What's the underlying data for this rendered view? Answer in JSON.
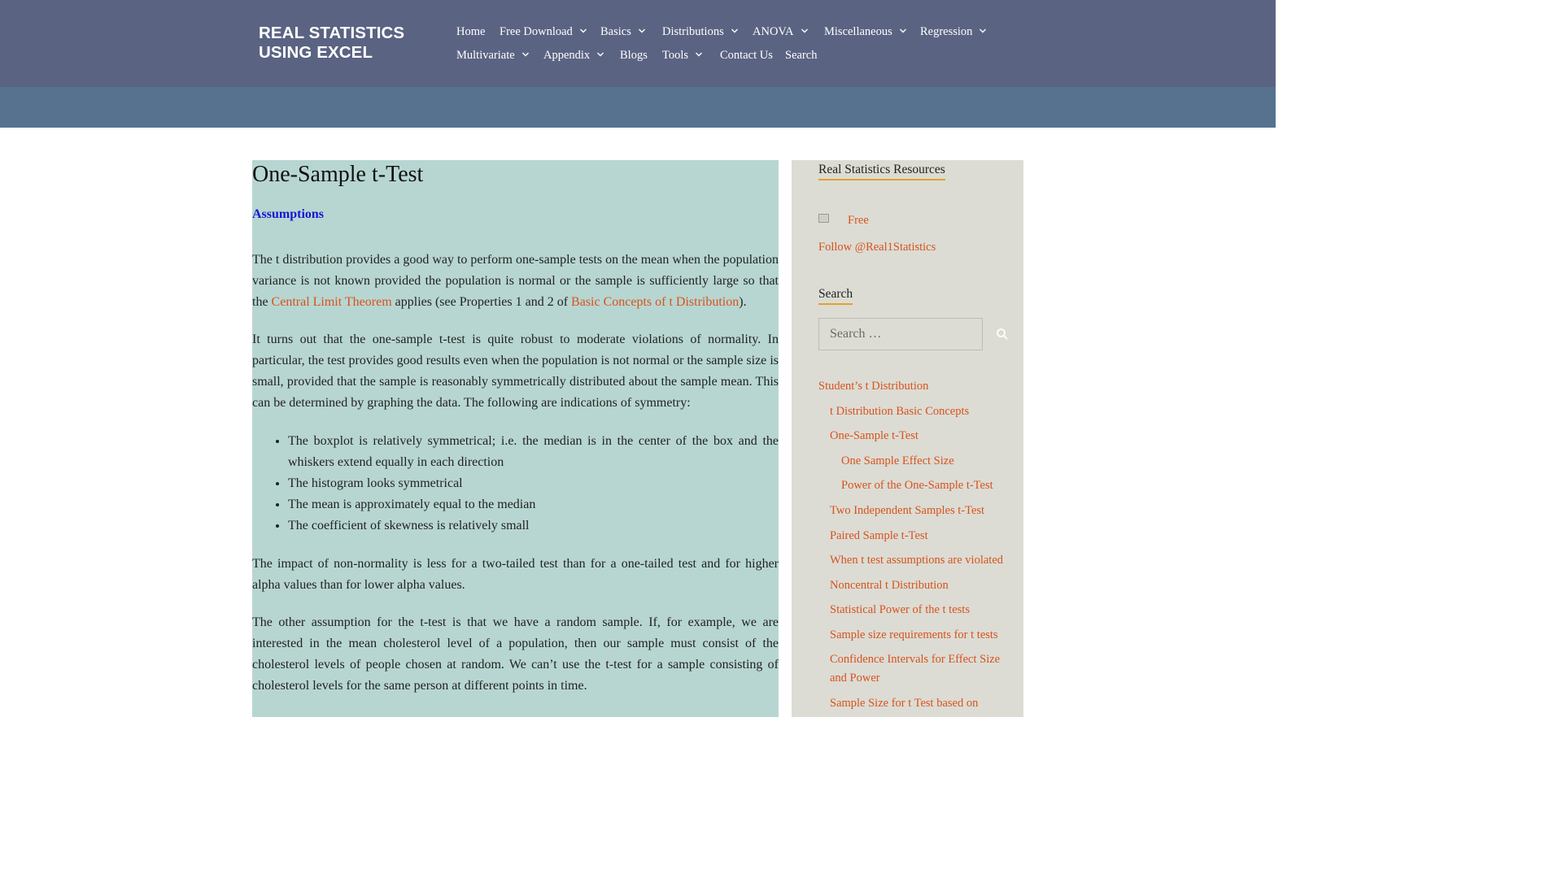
{
  "site": {
    "title": "REAL STATISTICS USING EXCEL"
  },
  "nav": {
    "row1": [
      {
        "label": "Home",
        "dropdown": false
      },
      {
        "label": "Free Download",
        "dropdown": true
      },
      {
        "label": "Basics",
        "dropdown": true
      },
      {
        "label": "Distributions",
        "dropdown": true
      },
      {
        "label": "ANOVA",
        "dropdown": true
      },
      {
        "label": "Miscellaneous",
        "dropdown": true
      },
      {
        "label": "Regression",
        "dropdown": true
      }
    ],
    "row2": [
      {
        "label": "Multivariate",
        "dropdown": true
      },
      {
        "label": "Appendix",
        "dropdown": true
      },
      {
        "label": "Blogs",
        "dropdown": false
      },
      {
        "label": "Tools",
        "dropdown": true
      },
      {
        "label": "Contact Us",
        "dropdown": false
      },
      {
        "label": "Search",
        "dropdown": false
      }
    ]
  },
  "article": {
    "title": "One-Sample t-Test",
    "subheading": "Assumptions",
    "p1_a": "The t distribution provides a good way to perform one-sample tests on the mean when the population variance is not known provided the population is normal or the sample is sufficiently large so that the ",
    "p1_link1": "Central Limit Theorem",
    "p1_b": " applies (see Properties 1 and 2 of ",
    "p1_link2": "Basic Concepts of t Distribution",
    "p1_c": ").",
    "p2": "It turns out that the one-sample t-test is quite robust to moderate violations of normality. In particular, the test provides good results even when the population is not normal or the sample size is small, provided that the sample is reasonably symmetrically distributed about the sample mean. This can be determined by graphing the data. The following are indications of symmetry:",
    "bullets": [
      "The boxplot is relatively symmetrical; i.e. the median is in the center of the box and the whiskers extend equally in each direction",
      "The histogram looks symmetrical",
      "The mean is approximately equal to the median",
      "The coefficient of skewness is relatively small"
    ],
    "p3": "The impact of non-normality is less for a two-tailed test than for a one-tailed test and for higher alpha values than for lower alpha values.",
    "p4": "The other assumption for the t-test is that we have a random sample. If, for example, we are interested in the mean cholesterol level of a population, then our sample must consist of the cholesterol levels of people chosen at random.  We can’t use the t-test for a sample consisting of cholesterol levels for the same person at different points in time."
  },
  "sidebar": {
    "resources_title": "Real Statistics Resources",
    "free_label": "Free",
    "follow_label": "Follow @Real1Statistics",
    "search_title": "Search",
    "search_placeholder": "Search …",
    "toc": [
      {
        "label": "Student’s t Distribution",
        "level": 0
      },
      {
        "label": "t Distribution Basic Concepts",
        "level": 1
      },
      {
        "label": "One-Sample t-Test",
        "level": 1
      },
      {
        "label": "One Sample Effect Size",
        "level": 2
      },
      {
        "label": "Power of the One-Sample t-Test",
        "level": 2
      },
      {
        "label": "Two Independent Samples t-Test",
        "level": 1
      },
      {
        "label": "Paired Sample t-Test",
        "level": 1
      },
      {
        "label": "When t test assumptions are violated",
        "level": 1
      },
      {
        "label": "Noncentral t Distribution",
        "level": 1
      },
      {
        "label": "Statistical Power of the t tests",
        "level": 1
      },
      {
        "label": "Sample size requirements for t tests",
        "level": 1
      },
      {
        "label": "Confidence Intervals for Effect Size and Power",
        "level": 1
      },
      {
        "label": "Sample Size for t Test based on",
        "level": 1
      }
    ]
  },
  "colors": {
    "header_bg": "#5b6382",
    "band_bg": "#56728f",
    "content_bg": "#b7d6d1",
    "sidebar_bg": "#dcdcd4",
    "link": "#d8521c",
    "subheading": "#1515d4",
    "widget_underline": "#e0a22a"
  },
  "icons": {
    "dropdown": "chevron-down-icon",
    "search": "search-icon",
    "image": "broken-image-icon"
  }
}
